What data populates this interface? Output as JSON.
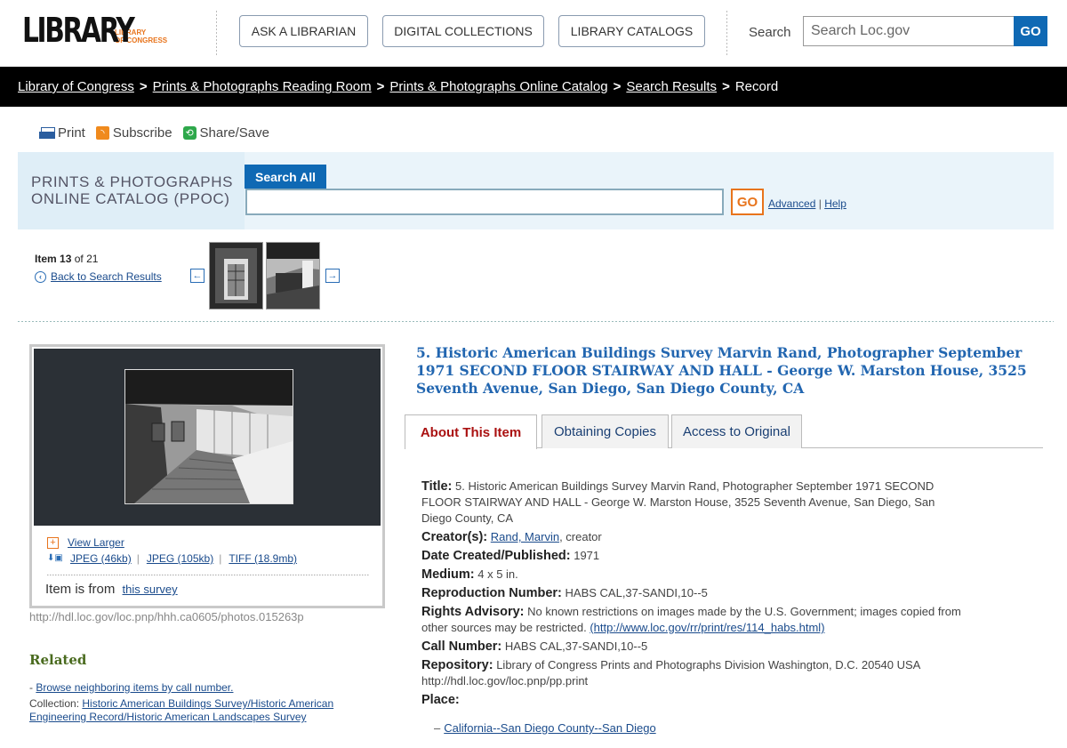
{
  "header": {
    "logo_main": "LIBRARY",
    "logo_sub_line1": "LIBRARY",
    "logo_sub_line2": "OF CONGRESS",
    "buttons": [
      "ASK A LIBRARIAN",
      "DIGITAL COLLECTIONS",
      "LIBRARY CATALOGS"
    ],
    "search_label": "Search",
    "search_placeholder": "Search Loc.gov",
    "search_go": "GO"
  },
  "breadcrumb": {
    "links": [
      "Library of Congress",
      "Prints & Photographs Reading Room",
      "Prints & Photographs Online Catalog",
      "Search Results"
    ],
    "separator": ">",
    "current": "Record"
  },
  "sharebar": {
    "print": "Print",
    "subscribe": "Subscribe",
    "share": "Share/Save"
  },
  "ppoc": {
    "title_line1": "PRINTS & PHOTOGRAPHS",
    "title_line2": "ONLINE CATALOG (PPOC)",
    "search_tab": "Search All",
    "go": "GO",
    "advanced": "Advanced",
    "help": "Help",
    "link_sep": "|"
  },
  "item_nav": {
    "item_label": "Item",
    "item_number": "13",
    "of_label": "of 21",
    "back": "Back to Search Results",
    "prev_arrow": "←",
    "next_arrow": "→"
  },
  "image_panel": {
    "view_larger": "View Larger",
    "downloads": [
      "JPEG (46kb)",
      "JPEG (105kb)",
      "TIFF (18.9mb)"
    ],
    "download_sep": "|",
    "from_text": "Item is from",
    "from_link": "this survey",
    "handle": "http://hdl.loc.gov/loc.pnp/hhh.ca0605/photos.015263p"
  },
  "related": {
    "heading": "Related",
    "browse": "Browse neighboring items by call number.",
    "collection_label": "Collection:",
    "collection_link": "Historic American Buildings Survey/Historic American Engineering Record/Historic American Landscapes Survey"
  },
  "record": {
    "title": "5. Historic American Buildings Survey Marvin Rand, Photographer September 1971 SECOND FLOOR STAIRWAY AND HALL - George W. Marston House, 3525 Seventh Avenue, San Diego, San Diego County, CA",
    "tabs": [
      "About This Item",
      "Obtaining Copies",
      "Access to Original"
    ],
    "fields": {
      "title_label": "Title:",
      "title_value": "5. Historic American Buildings Survey Marvin Rand, Photographer September 1971 SECOND FLOOR STAIRWAY AND HALL - George W. Marston House, 3525 Seventh Avenue, San Diego, San Diego County, CA",
      "creator_label": "Creator(s):",
      "creator_link": "Rand, Marvin",
      "creator_role": ", creator",
      "date_label": "Date Created/Published:",
      "date_value": "1971",
      "medium_label": "Medium:",
      "medium_value": "4 x 5 in.",
      "repro_label": "Reproduction Number:",
      "repro_value": "HABS CAL,37-SANDI,10--5",
      "rights_label": "Rights Advisory:",
      "rights_value": "No known restrictions on images made by the U.S. Government; images copied from other sources may be restricted.",
      "rights_link": "(http://www.loc.gov/rr/print/res/114_habs.html)",
      "call_label": "Call Number:",
      "call_value": "HABS CAL,37-SANDI,10--5",
      "repo_label": "Repository:",
      "repo_value": "Library of Congress Prints and Photographs Division Washington, D.C. 20540 USA http://hdl.loc.gov/loc.pnp/pp.print",
      "place_label": "Place:",
      "place_bullet": "–",
      "place_link": "California--San Diego County--San Diego"
    }
  }
}
